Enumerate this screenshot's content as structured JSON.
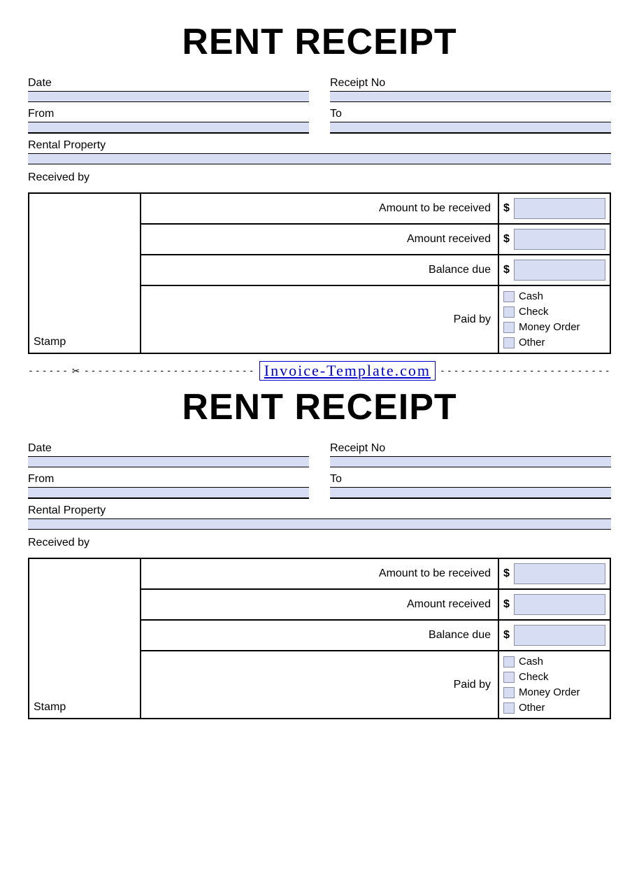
{
  "receipt": {
    "title": "RENT RECEIPT",
    "fields": {
      "date": "Date",
      "receipt_no": "Receipt No",
      "from": "From",
      "to": "To",
      "rental_property": "Rental Property",
      "received_by": "Received by",
      "stamp": "Stamp"
    },
    "amounts": {
      "to_be_received": "Amount to be received",
      "received": "Amount received",
      "balance_due": "Balance due",
      "currency": "$"
    },
    "paid_by": {
      "label": "Paid by",
      "options": [
        "Cash",
        "Check",
        "Money Order",
        "Other"
      ]
    }
  },
  "divider": {
    "link_text": "Invoice-Template.com"
  }
}
